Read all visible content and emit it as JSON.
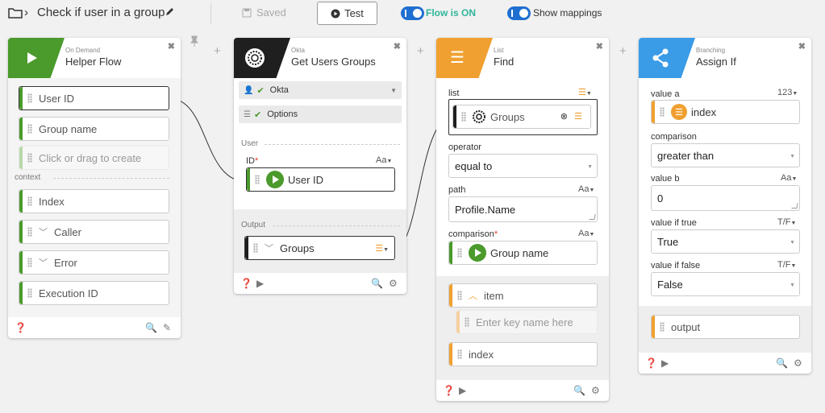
{
  "topbar": {
    "title": "Check if user in a group",
    "saved_label": "Saved",
    "test_label": "Test",
    "flow_toggle_label": "Flow is ON",
    "mappings_toggle_label": "Show mappings"
  },
  "cards": {
    "helper": {
      "small": "On Demand",
      "title": "Helper Flow",
      "fields": [
        "User ID",
        "Group name"
      ],
      "create_placeholder": "Click or drag to create",
      "context_label": "context",
      "context_fields": [
        "Index",
        "Caller",
        "Error",
        "Execution ID"
      ]
    },
    "okta": {
      "small": "Okta",
      "title": "Get Users Groups",
      "connection": "Okta",
      "options": "Options",
      "user_section": "User",
      "id_label": "ID",
      "id_required": "*",
      "id_type": "Aa",
      "id_value": "User ID",
      "output_section": "Output",
      "output_value": "Groups"
    },
    "find": {
      "small": "List",
      "title": "Find",
      "list_label": "list",
      "list_value": "Groups",
      "operator_label": "operator",
      "operator_value": "equal to",
      "path_label": "path",
      "path_type": "Aa",
      "path_value": "Profile.Name",
      "comparison_label": "comparison",
      "comparison_required": "*",
      "comparison_type": "Aa",
      "comparison_value": "Group name",
      "item_label": "item",
      "key_placeholder": "Enter key name here",
      "index_label": "index"
    },
    "assign": {
      "small": "Branching",
      "title": "Assign If",
      "value_a_label": "value a",
      "value_a_type": "123",
      "value_a_value": "index",
      "comparison_label": "comparison",
      "comparison_value": "greater than",
      "value_b_label": "value b",
      "value_b_type": "Aa",
      "value_b_value": "0",
      "true_label": "value if true",
      "true_type": "T/F",
      "true_value": "True",
      "false_label": "value if false",
      "false_type": "T/F",
      "false_value": "False",
      "output_label": "output"
    }
  },
  "colors": {
    "green": "#4a9a2c",
    "okta_dark": "#1f1f1f",
    "orange": "#f0a030",
    "blue": "#3a9be6",
    "toggle_blue": "#1f6fd0"
  }
}
